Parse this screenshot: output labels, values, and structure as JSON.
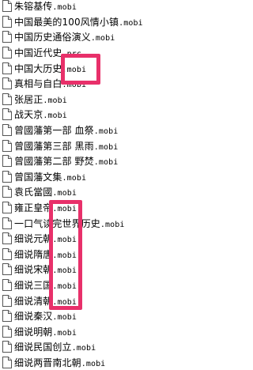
{
  "file_list": {
    "icon": "document-file-icon",
    "items": [
      {
        "name": "朱镕基传",
        "ext": ".mobi"
      },
      {
        "name": "中国最美的100风情小镇",
        "ext": ".mobi"
      },
      {
        "name": "中国历史通俗演义",
        "ext": ".mobi"
      },
      {
        "name": "中国近代史",
        "ext": ".prc"
      },
      {
        "name": "中国大历史",
        "ext": ".mobi"
      },
      {
        "name": "真相与自白",
        "ext": ".mobi"
      },
      {
        "name": "张居正",
        "ext": ".mobi"
      },
      {
        "name": "战天京",
        "ext": ".mobi"
      },
      {
        "name": "曾國藩第一部 血祭",
        "ext": ".mobi"
      },
      {
        "name": "曾國藩第三部 黑雨",
        "ext": ".mobi"
      },
      {
        "name": "曾國藩第二部 野焚",
        "ext": ".mobi"
      },
      {
        "name": "曾国藩文集",
        "ext": ".mobi"
      },
      {
        "name": "袁氏當國",
        "ext": ".mobi"
      },
      {
        "name": "雍正皇帝",
        "ext": ".mobi"
      },
      {
        "name": "一口气读完世界历史",
        "ext": ".mobi"
      },
      {
        "name": "细说元朝",
        "ext": ".mobi"
      },
      {
        "name": "细说隋唐",
        "ext": ".mobi"
      },
      {
        "name": "细说宋朝",
        "ext": ".mobi"
      },
      {
        "name": "细说三国",
        "ext": ".mobi"
      },
      {
        "name": "细说清朝",
        "ext": ".mobi"
      },
      {
        "name": "细说秦汉",
        "ext": ".mobi"
      },
      {
        "name": "细说明朝",
        "ext": ".mobi"
      },
      {
        "name": "细说民国创立",
        "ext": ".mobi"
      },
      {
        "name": "细说两晋南北朝",
        "ext": ".mobi"
      }
    ]
  },
  "highlight_color": "#e8306a"
}
